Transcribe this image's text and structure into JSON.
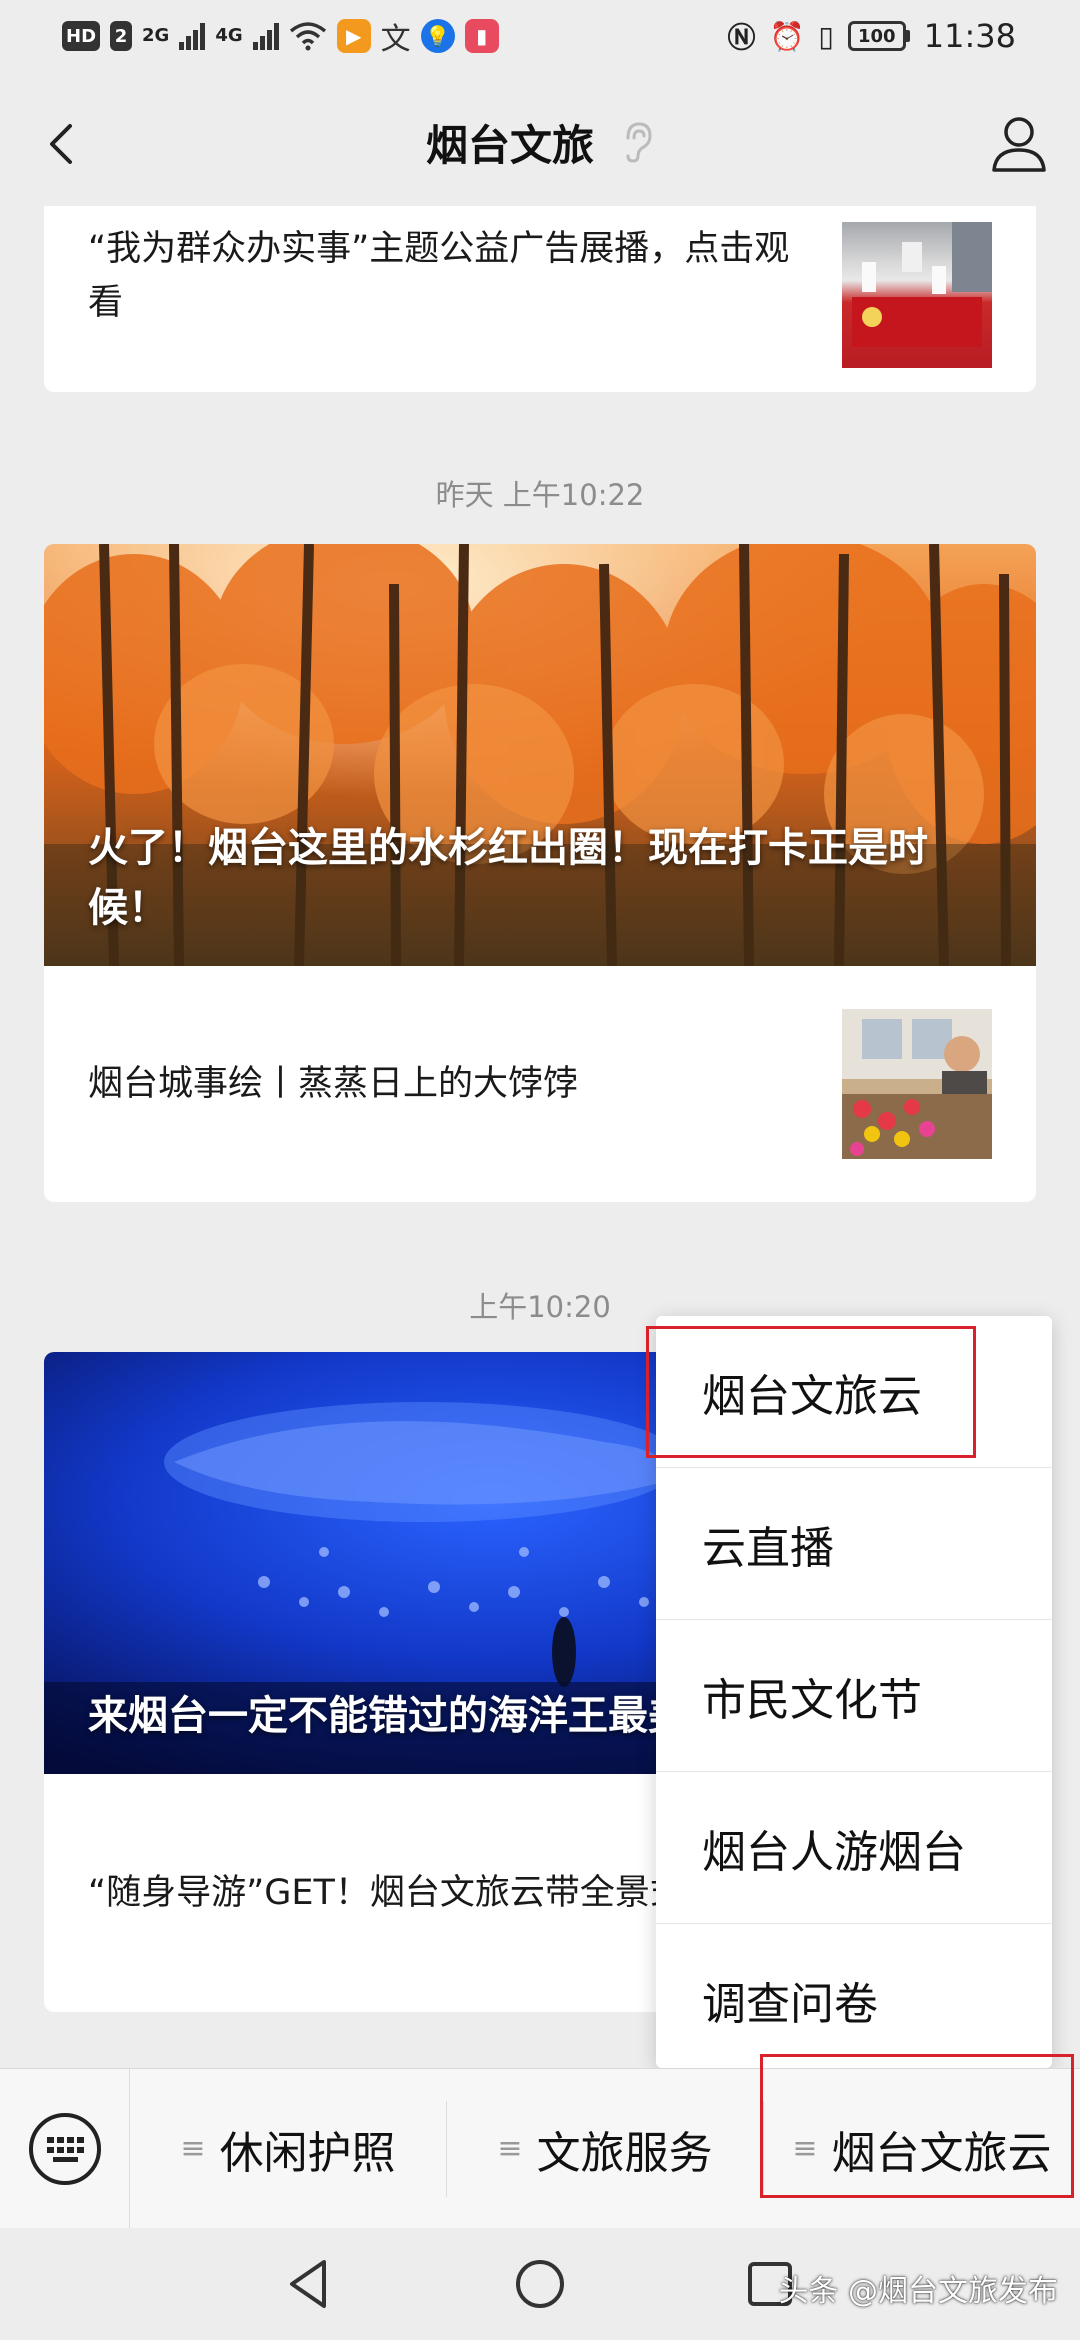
{
  "status_bar": {
    "hd": "HD",
    "sim": "2",
    "net1": "2G",
    "net2": "4G",
    "battery": "100",
    "time": "11:38"
  },
  "header": {
    "title": "烟台文旅"
  },
  "feed": {
    "card1_text": "“我为群众办实事”主题公益广告展播，点击观看",
    "time1": "昨天 上午10:22",
    "card2_hero_title": "火了！烟台这里的水杉红出圈！现在打卡正是时候！",
    "card2_item_text": "烟台城事绘丨蒸蒸日上的大饽饽",
    "time2": "上午10:20",
    "card3_hero_title": "来烟台一定不能错过的海洋王最美的诗与梦",
    "card3_item_text": "“随身导游”GET！烟台文旅云带全景式旅游新模式~"
  },
  "popup_menu": {
    "items": [
      "烟台文旅云",
      "云直播",
      "市民文化节",
      "烟台人游烟台",
      "调查问卷"
    ]
  },
  "menu_bar": {
    "items": [
      "休闲护照",
      "文旅服务",
      "烟台文旅云"
    ]
  },
  "watermark": "头条 @烟台文旅发布",
  "colors": {
    "highlight_box": "#d9212c",
    "background": "#ededed"
  }
}
